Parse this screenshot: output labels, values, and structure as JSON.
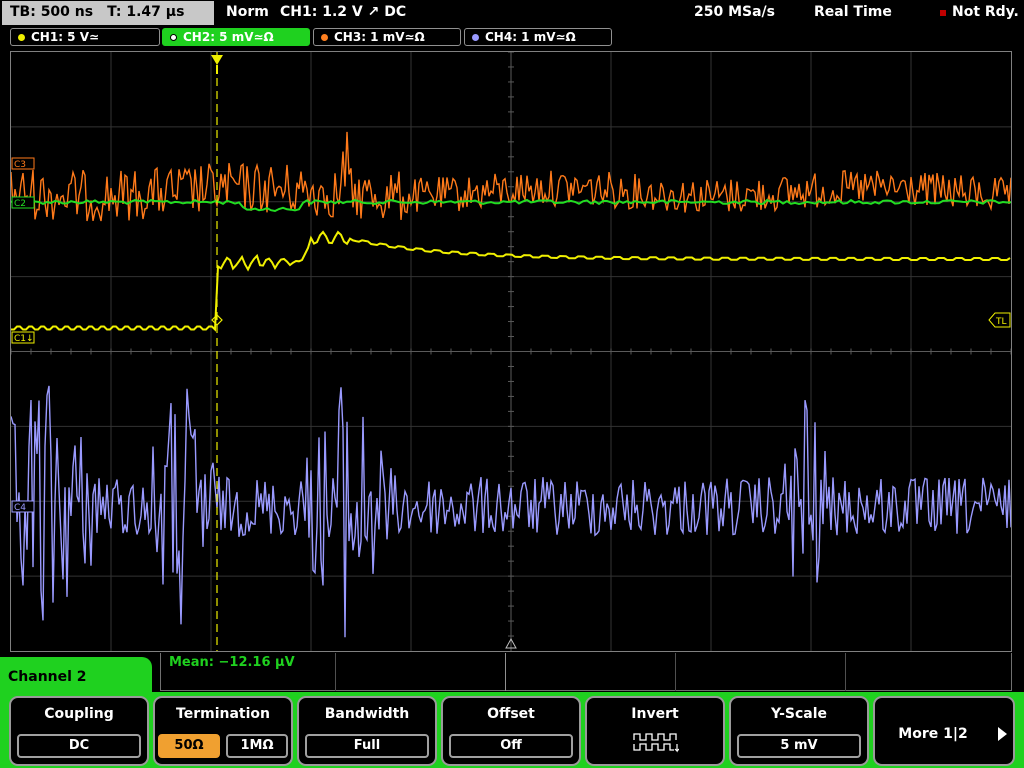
{
  "status": {
    "timebase": "TB: 500 ns",
    "trigger_time": "T: 1.47 µs",
    "trigger_mode": "Norm",
    "trigger_info": "CH1: 1.2 V ↗ DC",
    "sample_rate": "250 MSa/s",
    "acq_mode": "Real Time",
    "ready": "Not Rdy."
  },
  "channels": [
    {
      "label": "CH1: 5 V≃",
      "color": "#f0f000"
    },
    {
      "label": "CH2: 5 mV≃Ω",
      "color": "#1fd11f"
    },
    {
      "label": "CH3: 1 mV≃Ω",
      "color": "#ff8020"
    },
    {
      "label": "CH4: 1 mV≃Ω",
      "color": "#9a9aff"
    }
  ],
  "markers": {
    "ch1": "C1↓",
    "ch2": "C2",
    "ch3": "C3",
    "ch4": "C4",
    "trigger_level": "TL"
  },
  "measurement": {
    "mean": "Mean: −12.16 µV"
  },
  "menu_title": "Channel 2",
  "softkeys": {
    "coupling": {
      "title": "Coupling",
      "value": "DC"
    },
    "termination": {
      "title": "Termination",
      "opt1": "50Ω",
      "opt2": "1MΩ"
    },
    "bandwidth": {
      "title": "Bandwidth",
      "value": "Full"
    },
    "offset": {
      "title": "Offset",
      "value": "Off"
    },
    "invert": {
      "title": "Invert"
    },
    "yscale": {
      "title": "Y-Scale",
      "value": "5 mV"
    },
    "more": {
      "label": "More 1|2"
    }
  }
}
